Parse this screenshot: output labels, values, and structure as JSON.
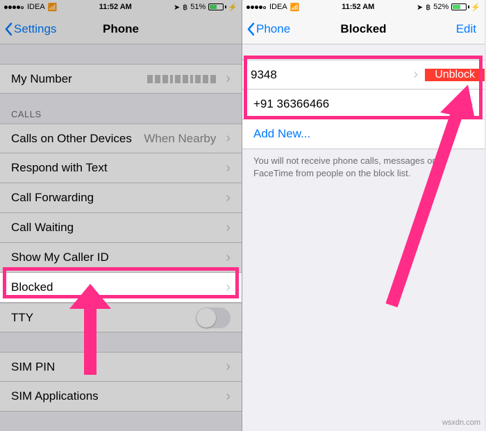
{
  "left": {
    "statusbar": {
      "carrier": "IDEA",
      "time": "11:52 AM",
      "batt": "51%"
    },
    "nav": {
      "back": "Settings",
      "title": "Phone"
    },
    "mynumber": {
      "label": "My Number"
    },
    "calls_header": "CALLS",
    "rows": {
      "other_devices": {
        "label": "Calls on Other Devices",
        "value": "When Nearby"
      },
      "respond": {
        "label": "Respond with Text"
      },
      "forwarding": {
        "label": "Call Forwarding"
      },
      "waiting": {
        "label": "Call Waiting"
      },
      "callerid": {
        "label": "Show My Caller ID"
      },
      "blocked": {
        "label": "Blocked"
      },
      "tty": {
        "label": "TTY"
      },
      "simpin": {
        "label": "SIM PIN"
      },
      "simapps": {
        "label": "SIM Applications"
      }
    }
  },
  "right": {
    "statusbar": {
      "carrier": "IDEA",
      "time": "11:52 AM",
      "batt": "52%"
    },
    "nav": {
      "back": "Phone",
      "title": "Blocked",
      "edit": "Edit"
    },
    "rows": {
      "r1": {
        "label": "9348",
        "action": "Unblock"
      },
      "r2": {
        "label": "+91 36366466"
      },
      "addnew": {
        "label": "Add New..."
      }
    },
    "desc": "You will not receive phone calls, messages or FaceTime from people on the block list."
  },
  "watermark": "wsxdn.com"
}
